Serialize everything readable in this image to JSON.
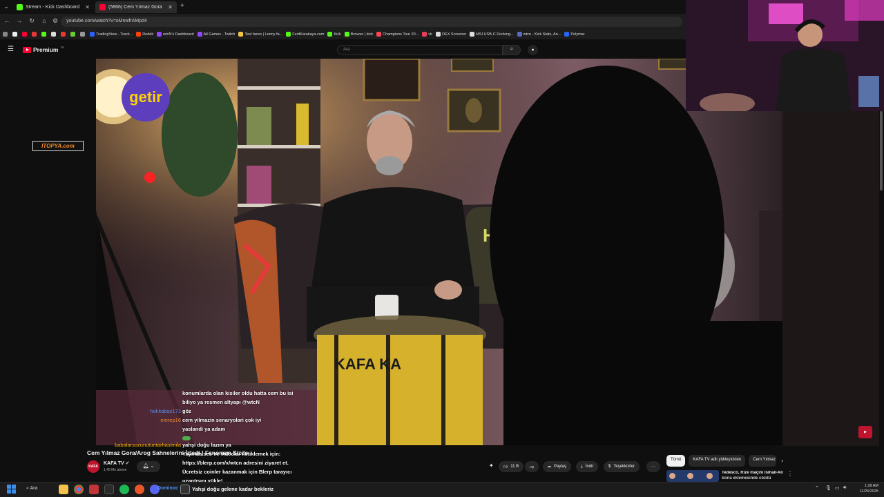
{
  "tabs": [
    {
      "label": "Stream - Kick Dashboard",
      "color": "#53fc18"
    },
    {
      "label": "(5866) Cem Yılmaz Gora/A",
      "color": "#ff0033"
    }
  ],
  "address": {
    "url": "youtube.com/watch?v=oMnwfrAMpd4"
  },
  "bookmarks": [
    {
      "label": "TradingView - Track...",
      "color": "#2962ff"
    },
    {
      "label": "Reddit",
      "color": "#ff4500"
    },
    {
      "label": "wtcN's Dashboard",
      "color": "#9146ff"
    },
    {
      "label": "All Games - Twitch",
      "color": "#9146ff"
    },
    {
      "label": "Text faces | Lenny fa...",
      "color": "#f4c542"
    },
    {
      "label": "FeritKarakaya.com",
      "color": "#53fc18"
    },
    {
      "label": "Kick",
      "color": "#53fc18"
    },
    {
      "label": "Browse | kick",
      "color": "#53fc18"
    },
    {
      "label": "Champions Tour 20...",
      "color": "#ff4655"
    },
    {
      "label": "vlr",
      "color": "#e84057"
    },
    {
      "label": "DEX Screener",
      "color": "#dddddd"
    },
    {
      "label": "MSI USB-C Docking...",
      "color": "#dddddd"
    },
    {
      "label": "wtcn - Kick Stats, An...",
      "color": "#5c6bc0"
    },
    {
      "label": "Polymar",
      "color": "#2962ff"
    }
  ],
  "youtube": {
    "logo": "Premium",
    "logo_sup": "TR",
    "search_placeholder": "Ara"
  },
  "video": {
    "sponsor_logo": "getir",
    "overlay_site": "ITOPYA.com"
  },
  "chat": [
    {
      "user": "",
      "user_color": "#ffffff",
      "msg": "konumlarda olan kisiler oldu hatta cem bu isi"
    },
    {
      "user": "",
      "user_color": "#ffffff",
      "msg": "biliyo ya resmen altyapı @wtcN"
    },
    {
      "user": "hokkabaz171",
      "user_color": "#5b8def",
      "msg": "göz"
    },
    {
      "user": "emrep16",
      "user_color": "#f28b30",
      "msg": "cem yilmazin senaryolari çok iyi"
    },
    {
      "user": "",
      "user_color": "#e53935",
      "msg": "yaslandi ya adam"
    },
    {
      "user": "",
      "user_color": "#e53935",
      "msg": ""
    },
    {
      "user": "babalarsozunutuntarhasimila",
      "user_color": "#f5b400",
      "msg": "yahşi doğu lazım ya"
    },
    {
      "user": "",
      "user_color": "#ffffff",
      "msg": "Yayında ses ve videolar iletiklemek için:"
    },
    {
      "user": "",
      "user_color": "#ffffff",
      "msg": "https://blerp.com/x/wtcn adresini ziyaret et."
    },
    {
      "user": "",
      "user_color": "#ffffff",
      "msg": "Ücretsiz coinler kazanmak için Blerp tarayıcı"
    },
    {
      "user": "",
      "user_color": "#ffffff",
      "msg": "uzantısını yükle!"
    }
  ],
  "below": {
    "title": "Cem Yılmaz Gora/Arog Sahnelerini İzledi | Fenomen Sizde",
    "channel": "KAFA TV",
    "channel_avatar": "KAFA",
    "subs": "1,48 Mn abone",
    "likes": "11 B",
    "share": "Paylaş",
    "download": "İndir",
    "thanks": "Teşekkürler",
    "more": "···"
  },
  "chips": [
    "Tümü",
    "KAFA TV adlı yükleyiciden",
    "Cem Yılmaz"
  ],
  "recommend": {
    "title": "Tedesco, Rize maçını İsmail-Ali",
    "subtitle": "Sona eklemesinde cözdü"
  },
  "stream_overlay": {
    "bottom_text": "Yahşi doğu gelene kadar bekleriz",
    "bottom_user": "Dominoc"
  },
  "taskbar": {
    "search": "Ara",
    "time": "1:28 AM",
    "date": "11/25/2025"
  }
}
